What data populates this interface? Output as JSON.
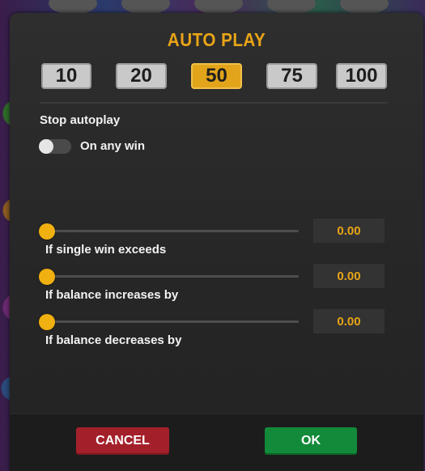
{
  "dialog": {
    "title": "AUTO PLAY",
    "counts": [
      {
        "label": "10",
        "active": false
      },
      {
        "label": "20",
        "active": false
      },
      {
        "label": "50",
        "active": true
      },
      {
        "label": "75",
        "active": false
      },
      {
        "label": "100",
        "active": false
      }
    ],
    "stop_label": "Stop autoplay",
    "toggle": {
      "label": "On any win",
      "on": false
    },
    "sliders": [
      {
        "label": "If single win exceeds",
        "value": "0.00",
        "level": 0
      },
      {
        "label": "If balance increases by",
        "value": "0.00",
        "level": 0
      },
      {
        "label": "If balance decreases by",
        "value": "0.00",
        "level": 0
      }
    ],
    "cancel_label": "CANCEL",
    "ok_label": "OK"
  },
  "colors": {
    "accent": "#e8a417",
    "cancel": "#a3202a",
    "ok": "#128a3a"
  }
}
